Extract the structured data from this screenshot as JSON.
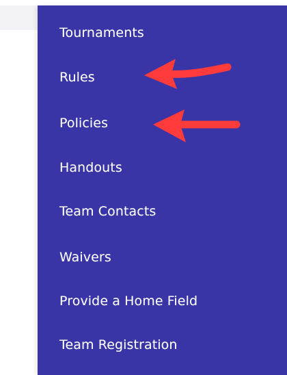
{
  "menu": {
    "items": [
      {
        "label": "Tournaments"
      },
      {
        "label": "Rules"
      },
      {
        "label": "Policies"
      },
      {
        "label": "Handouts"
      },
      {
        "label": "Team Contacts"
      },
      {
        "label": "Waivers"
      },
      {
        "label": "Provide a Home Field"
      },
      {
        "label": "Team Registration"
      }
    ]
  },
  "annotations": {
    "arrow_color": "#ff3b3b",
    "arrows": [
      {
        "points_to": "Rules"
      },
      {
        "points_to": "Policies"
      }
    ]
  },
  "colors": {
    "menu_background": "#3935a6",
    "menu_text": "#ffffff"
  }
}
